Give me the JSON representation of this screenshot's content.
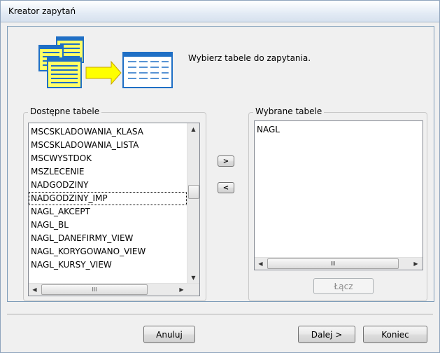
{
  "window": {
    "title": "Kreator zapytań"
  },
  "intro": {
    "text": "Wybierz tabele do zapytania."
  },
  "available": {
    "label": "Dostępne tabele",
    "items": [
      "MSCSKLADOWANIA_KLASA",
      "MSCSKLADOWANIA_LISTA",
      "MSCWYSTDOK",
      "MSZLECENIE",
      "NADGODZINY",
      "NADGODZINY_IMP",
      "NAGL_AKCEPT",
      "NAGL_BL",
      "NAGL_DANEFIRMY_VIEW",
      "NAGL_KORYGOWANO_VIEW",
      "NAGL_KURSY_VIEW"
    ],
    "focused_item": "NADGODZINY_IMP",
    "scroll_grip": "III"
  },
  "selected": {
    "label": "Wybrane tabele",
    "items": [
      "NAGL"
    ],
    "scroll_grip": "III"
  },
  "buttons": {
    "add": ">",
    "remove": "<",
    "join": "Łącz",
    "cancel": "Anuluj",
    "next": "Dalej >",
    "finish": "Koniec"
  },
  "icons": {
    "up": "▲",
    "down": "▼",
    "left": "◀",
    "right": "▶"
  },
  "colors": {
    "title_bar": "#e3ebf5",
    "icon_yellow": "#ffff66",
    "icon_blue": "#1f6fc5"
  }
}
